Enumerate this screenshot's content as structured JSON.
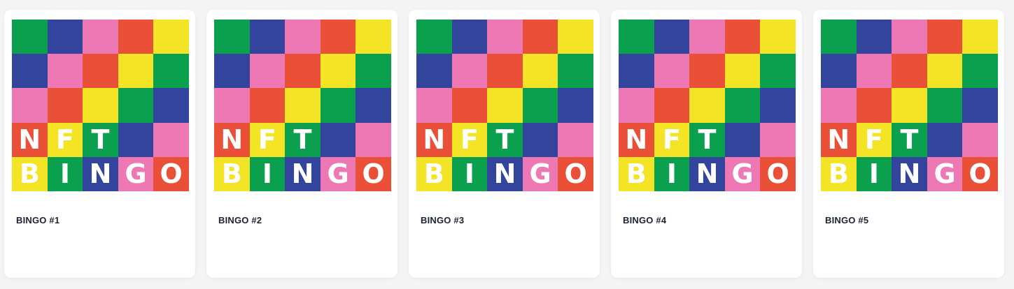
{
  "colors": {
    "G": "#0aa04e",
    "B": "#33449c",
    "P": "#ee78b3",
    "R": "#ea5038",
    "Y": "#f4e426"
  },
  "art": {
    "rows": [
      [
        "G",
        "B",
        "P",
        "R",
        "Y"
      ],
      [
        "B",
        "P",
        "R",
        "Y",
        "G"
      ],
      [
        "P",
        "R",
        "Y",
        "G",
        "B"
      ],
      [
        "R",
        "Y",
        "G",
        "B",
        "P"
      ],
      [
        "Y",
        "G",
        "B",
        "P",
        "R"
      ]
    ],
    "letters": [
      [
        "",
        "",
        "",
        "",
        ""
      ],
      [
        "",
        "",
        "",
        "",
        ""
      ],
      [
        "",
        "",
        "",
        "",
        ""
      ],
      [
        "N",
        "F",
        "T",
        "",
        ""
      ],
      [
        "B",
        "I",
        "N",
        "G",
        "O"
      ]
    ]
  },
  "cards": [
    {
      "title": "BINGO #1"
    },
    {
      "title": "BINGO #2"
    },
    {
      "title": "BINGO #3"
    },
    {
      "title": "BINGO #4"
    },
    {
      "title": "BINGO #5"
    }
  ]
}
